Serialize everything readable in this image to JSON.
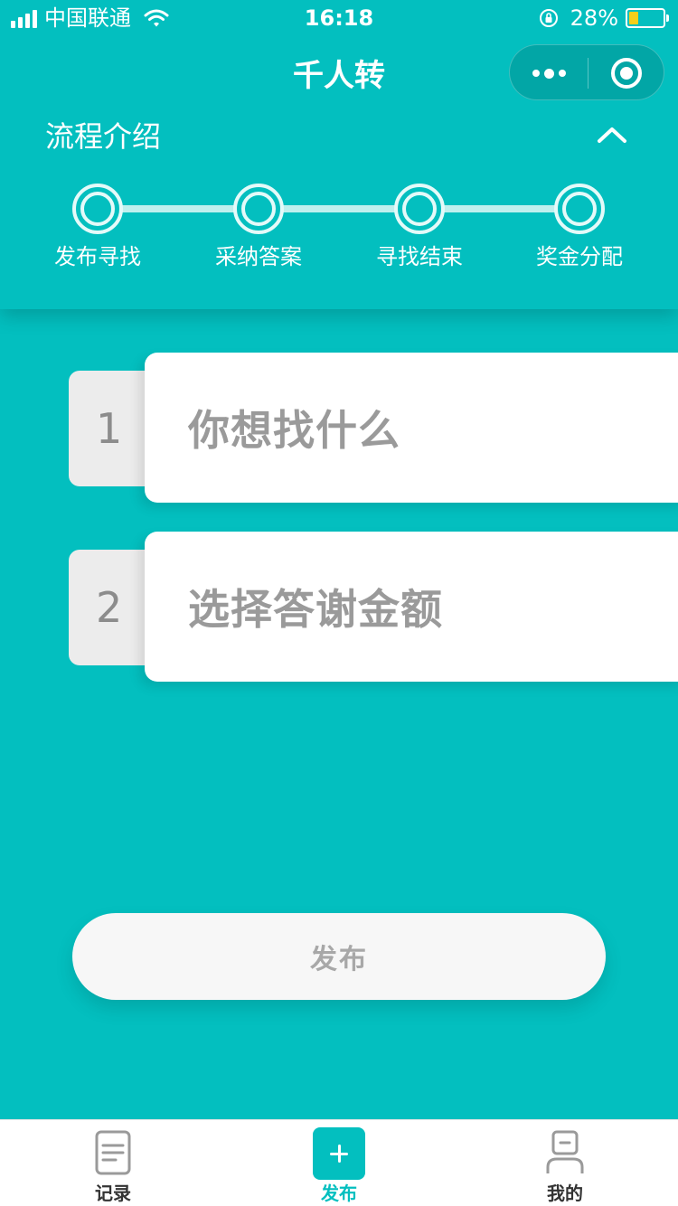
{
  "status_bar": {
    "carrier": "中国联通",
    "time": "16:18",
    "battery_percent": "28%",
    "battery_level": 0.28
  },
  "nav": {
    "title": "千人转"
  },
  "process": {
    "title": "流程介绍",
    "steps": [
      {
        "label": "发布寻找"
      },
      {
        "label": "采纳答案"
      },
      {
        "label": "寻找结束"
      },
      {
        "label": "奖金分配"
      }
    ]
  },
  "form": {
    "rows": [
      {
        "number": "1",
        "placeholder": "你想找什么"
      },
      {
        "number": "2",
        "placeholder": "选择答谢金额"
      }
    ],
    "publish_label": "发布"
  },
  "tab_bar": {
    "items": [
      {
        "label": "记录",
        "icon": "document-icon"
      },
      {
        "label": "发布",
        "icon": "add-icon"
      },
      {
        "label": "我的",
        "icon": "user-icon"
      }
    ]
  },
  "colors": {
    "accent": "#03BFBF",
    "battery_fill": "#F5CF1A"
  }
}
